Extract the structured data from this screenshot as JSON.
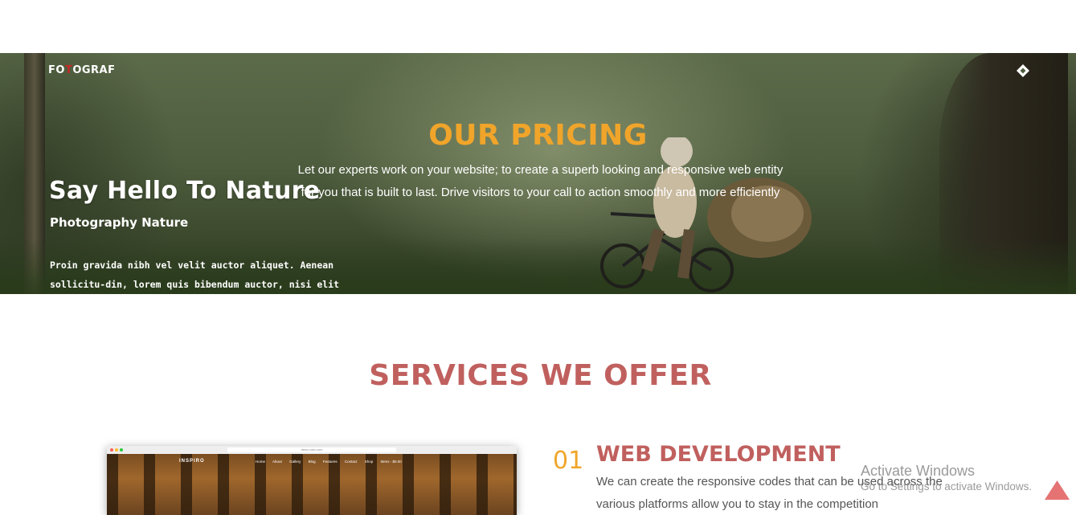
{
  "hero": {
    "logo_prefix": "FO",
    "logo_accent": "T",
    "logo_suffix": "OGRAF",
    "menu_icon": "diamond-menu-icon",
    "background_image": {
      "title": "Say Hello To Nature",
      "subtitle": "Photography Nature",
      "paragraph": "Proin gravida nibh vel velit auctor aliquet. Aenean sollicitu-din, lorem quis bibendum auctor, nisi elit consequat ipsum,"
    },
    "pricing_title": "OUR PRICING",
    "pricing_description": "Let our experts work on your website; to create a superb looking and responsive web entity for you that is built to last. Drive visitors to your call to action smoothly and more efficiently"
  },
  "services": {
    "title": "SERVICES WE OFFER",
    "items": [
      {
        "number": "01",
        "title": "WEB DEVELOPMENT",
        "description": "We can create the responsive codes that can be used across the various platforms allow you to stay in the competition",
        "preview": {
          "url": "demo.xsin.com",
          "site_logo": "INSPIRO",
          "nav": [
            "Home",
            "About",
            "Gallery",
            "Blog",
            "Features",
            "Contact",
            "Shop",
            "Items - $0.00"
          ]
        }
      }
    ]
  },
  "overlay": {
    "activate_line1": "Activate Windows",
    "activate_line2": "Go to Settings to activate Windows."
  },
  "back_to_top": {
    "icon": "triangle-up-icon",
    "color": "#e57373"
  },
  "colors": {
    "accent_orange": "#f0a52a",
    "accent_red": "#c0605e",
    "text_gray": "#555555"
  }
}
